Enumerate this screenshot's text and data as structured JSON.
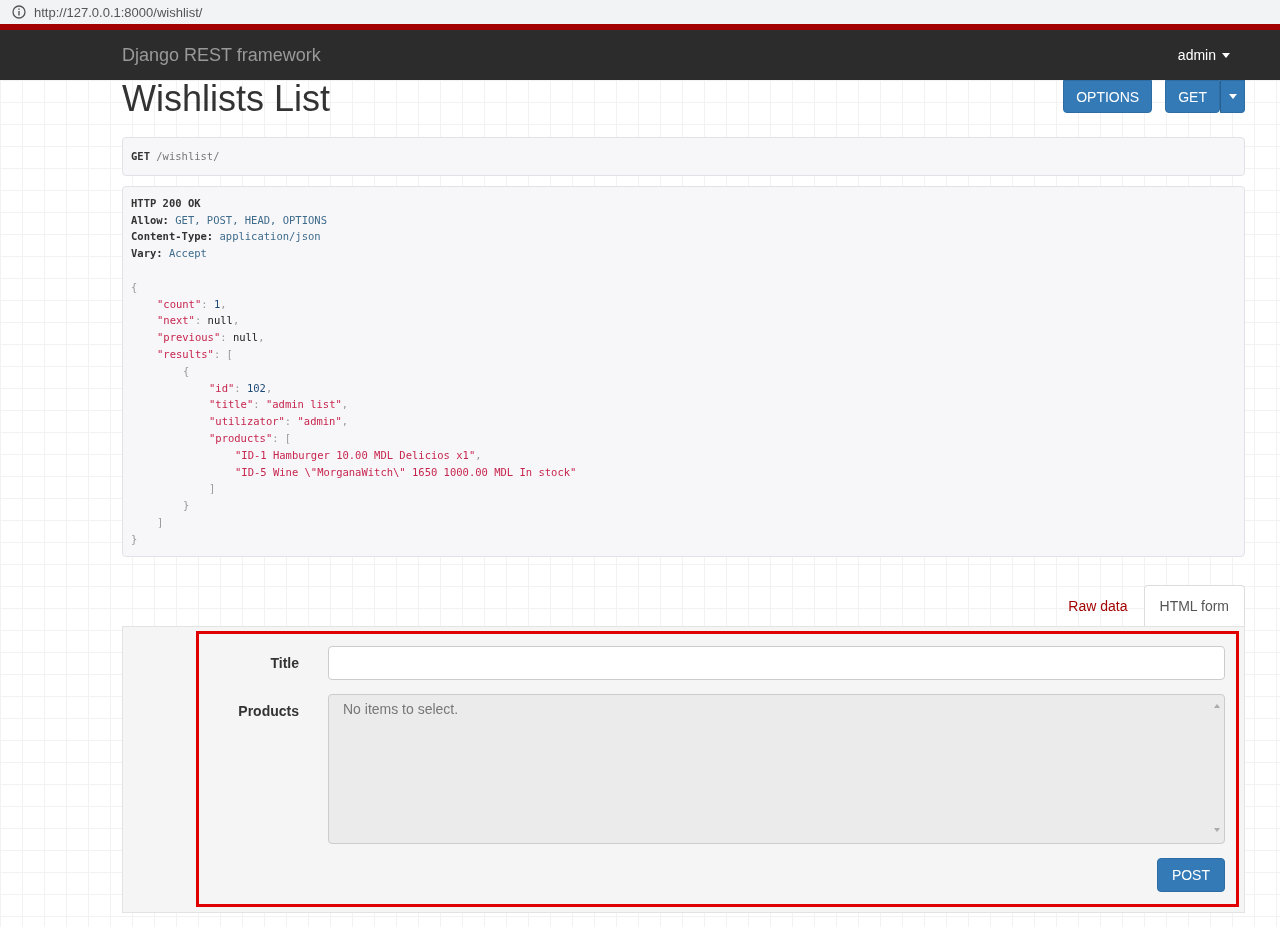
{
  "address_bar": {
    "url": "http://127.0.0.1:8000/wishlist/"
  },
  "navbar": {
    "brand": "Django REST framework",
    "user": "admin"
  },
  "page": {
    "title": "Wishlists List",
    "buttons": [
      {
        "label": "OPTIONS",
        "kind": "plain"
      },
      {
        "label": "GET",
        "kind": "split"
      }
    ]
  },
  "request": {
    "method": "GET",
    "path": "/wishlist/"
  },
  "response": {
    "status": "HTTP 200 OK",
    "headers": [
      {
        "name": "Allow:",
        "value": "GET, POST, HEAD, OPTIONS"
      },
      {
        "name": "Content-Type:",
        "value": "application/json"
      },
      {
        "name": "Vary:",
        "value": "Accept"
      }
    ],
    "body": [
      {
        "tokens": [
          {
            "kind": "punct",
            "text": "{"
          }
        ],
        "children": [
          {
            "tokens": [
              {
                "kind": "key",
                "text": "\"count\""
              },
              {
                "kind": "punct",
                "text": ": "
              },
              {
                "kind": "num",
                "text": "1"
              },
              {
                "kind": "punct",
                "text": ","
              }
            ]
          },
          {
            "tokens": [
              {
                "kind": "key",
                "text": "\"next\""
              },
              {
                "kind": "punct",
                "text": ": "
              },
              {
                "kind": "lit",
                "text": "null"
              },
              {
                "kind": "punct",
                "text": ","
              }
            ]
          },
          {
            "tokens": [
              {
                "kind": "key",
                "text": "\"previous\""
              },
              {
                "kind": "punct",
                "text": ": "
              },
              {
                "kind": "lit",
                "text": "null"
              },
              {
                "kind": "punct",
                "text": ","
              }
            ]
          },
          {
            "tokens": [
              {
                "kind": "key",
                "text": "\"results\""
              },
              {
                "kind": "punct",
                "text": ": ["
              }
            ],
            "children": [
              {
                "tokens": [
                  {
                    "kind": "punct",
                    "text": "{"
                  }
                ],
                "children": [
                  {
                    "tokens": [
                      {
                        "kind": "key",
                        "text": "\"id\""
                      },
                      {
                        "kind": "punct",
                        "text": ": "
                      },
                      {
                        "kind": "num",
                        "text": "102"
                      },
                      {
                        "kind": "punct",
                        "text": ","
                      }
                    ]
                  },
                  {
                    "tokens": [
                      {
                        "kind": "key",
                        "text": "\"title\""
                      },
                      {
                        "kind": "punct",
                        "text": ": "
                      },
                      {
                        "kind": "str",
                        "text": "\"admin list\""
                      },
                      {
                        "kind": "punct",
                        "text": ","
                      }
                    ]
                  },
                  {
                    "tokens": [
                      {
                        "kind": "key",
                        "text": "\"utilizator\""
                      },
                      {
                        "kind": "punct",
                        "text": ": "
                      },
                      {
                        "kind": "str",
                        "text": "\"admin\""
                      },
                      {
                        "kind": "punct",
                        "text": ","
                      }
                    ]
                  },
                  {
                    "tokens": [
                      {
                        "kind": "key",
                        "text": "\"products\""
                      },
                      {
                        "kind": "punct",
                        "text": ": ["
                      }
                    ],
                    "children": [
                      {
                        "tokens": [
                          {
                            "kind": "str",
                            "text": "\"ID-1 Hamburger 10.00 MDL Delicios x1\""
                          },
                          {
                            "kind": "punct",
                            "text": ","
                          }
                        ]
                      },
                      {
                        "tokens": [
                          {
                            "kind": "str",
                            "text": "\"ID-5 Wine \\\"MorganaWitch\\\" 1650 1000.00 MDL In stock\""
                          }
                        ]
                      }
                    ]
                  },
                  {
                    "tokens": [
                      {
                        "kind": "punct",
                        "text": "]"
                      }
                    ]
                  }
                ]
              },
              {
                "tokens": [
                  {
                    "kind": "punct",
                    "text": "}"
                  }
                ]
              }
            ]
          },
          {
            "tokens": [
              {
                "kind": "punct",
                "text": "]"
              }
            ]
          }
        ]
      },
      {
        "tokens": [
          {
            "kind": "punct",
            "text": "}"
          }
        ]
      }
    ]
  },
  "form_tabs": [
    {
      "label": "Raw data",
      "selected": false
    },
    {
      "label": "HTML form",
      "selected": true
    }
  ],
  "form": {
    "fields": [
      {
        "label": "Title",
        "kind": "text"
      },
      {
        "label": "Products",
        "kind": "select",
        "placeholder": "No items to select."
      }
    ],
    "submit": "POST"
  }
}
